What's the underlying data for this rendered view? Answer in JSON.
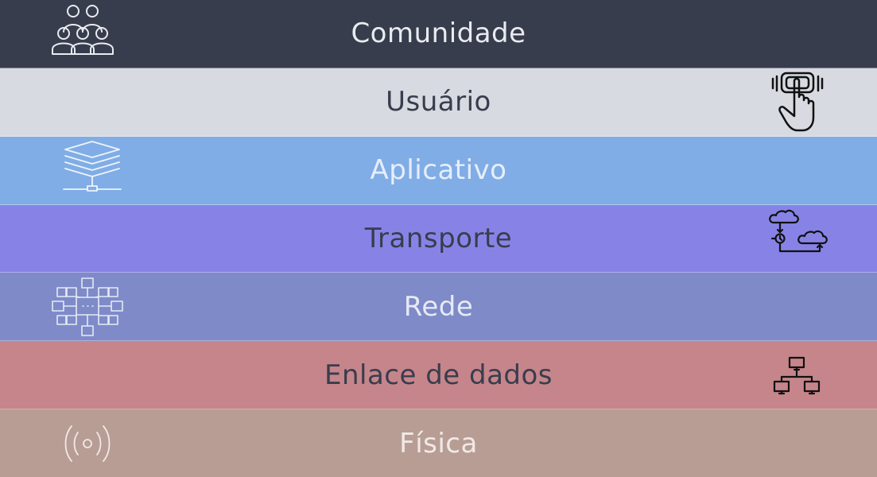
{
  "layers": [
    {
      "label": "Comunidade",
      "bg": "#383d4d",
      "fg": "#e9ebf0",
      "icon": "community-icon",
      "icon_side": "left",
      "icon_color": "#e9ebf0"
    },
    {
      "label": "Usuário",
      "bg": "#d7dae1",
      "fg": "#383d4d",
      "icon": "tap-hand-icon",
      "icon_side": "right",
      "icon_color": "#111111"
    },
    {
      "label": "Aplicativo",
      "bg": "#80ade6",
      "fg": "#e6eefa",
      "icon": "layers-network-icon",
      "icon_side": "left",
      "icon_color": "#eef4fc"
    },
    {
      "label": "Transporte",
      "bg": "#8783e6",
      "fg": "#383d4d",
      "icon": "cloud-transfer-icon",
      "icon_side": "right",
      "icon_color": "#111111"
    },
    {
      "label": "Rede",
      "bg": "#7e8bc8",
      "fg": "#e6e9f5",
      "icon": "network-grid-icon",
      "icon_side": "left",
      "icon_color": "#e6e9f5"
    },
    {
      "label": "Enlace de dados",
      "bg": "#c6858b",
      "fg": "#383d4d",
      "icon": "network-topology-icon",
      "icon_side": "right",
      "icon_color": "#111111"
    },
    {
      "label": "Física",
      "bg": "#b89d95",
      "fg": "#f1e9e6",
      "icon": "radio-signal-icon",
      "icon_side": "left",
      "icon_color": "#f1e9e6"
    }
  ]
}
